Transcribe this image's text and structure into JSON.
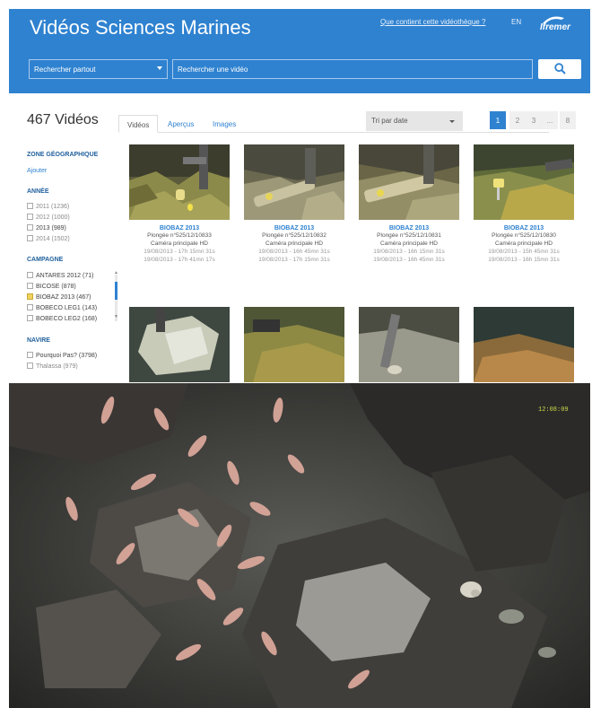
{
  "header": {
    "title": "Vidéos Sciences Marines",
    "about_link": "Que contient cette vidéothèque ?",
    "language": "EN",
    "logo_text": "Ifremer"
  },
  "search": {
    "scope": "Rechercher partout",
    "placeholder": "Rechercher une vidéo"
  },
  "results": {
    "count_label": "467 Vidéos"
  },
  "tabs": [
    {
      "label": "Vidéos",
      "active": true
    },
    {
      "label": "Aperçus",
      "active": false
    },
    {
      "label": "Images",
      "active": false
    }
  ],
  "sort": {
    "label": "Tri par date"
  },
  "pager": {
    "pages": [
      "1",
      "2",
      "3",
      "...",
      "8"
    ],
    "current": "1"
  },
  "sidebar": {
    "zone": {
      "heading": "ZONE GÉOGRAPHIQUE",
      "add_link": "Ajouter"
    },
    "annee": {
      "heading": "ANNÉE",
      "items": [
        "2011 (1236)",
        "2012 (1000)",
        "2013 (989)",
        "2014 (1502)"
      ]
    },
    "campagne": {
      "heading": "CAMPAGNE",
      "items": [
        "ANTARES 2012 (71)",
        "BICOSE (878)",
        "BIOBAZ 2013 (467)",
        "BOBECO LEG1 (143)",
        "BOBECO LEG2 (168)"
      ]
    },
    "navire": {
      "heading": "NAVIRE",
      "items": [
        "Pourquoi Pas? (3798)",
        "Thalassa (979)"
      ]
    }
  },
  "videos": [
    {
      "campaign": "BIOBAZ 2013",
      "dive": "Plongée n°525/12/10833",
      "camera": "Caméra principale HD",
      "start": "19/08/2013 - 17h 15mn 31s",
      "end": "19/08/2013 - 17h 41mn 17s"
    },
    {
      "campaign": "BIOBAZ 2013",
      "dive": "Plongée n°525/12/10832",
      "camera": "Caméra principale HD",
      "start": "19/08/2013 - 16h 45mn 31s",
      "end": "19/08/2013 - 17h 15mn 31s"
    },
    {
      "campaign": "BIOBAZ 2013",
      "dive": "Plongée n°525/12/10831",
      "camera": "Caméra principale HD",
      "start": "19/08/2013 - 16h 15mn 31s",
      "end": "19/08/2013 - 16h 45mn 31s"
    },
    {
      "campaign": "BIOBAZ 2013",
      "dive": "Plongée n°525/12/10830",
      "camera": "Caméra principale HD",
      "start": "19/08/2013 - 15h 45mn 31s",
      "end": "19/08/2013 - 16h 15mn 31s"
    }
  ],
  "photo_overlay": {
    "time": "12:08:09"
  },
  "colors": {
    "brand_blue": "#2f82d0",
    "checked_yellow": "#f0d35b"
  }
}
